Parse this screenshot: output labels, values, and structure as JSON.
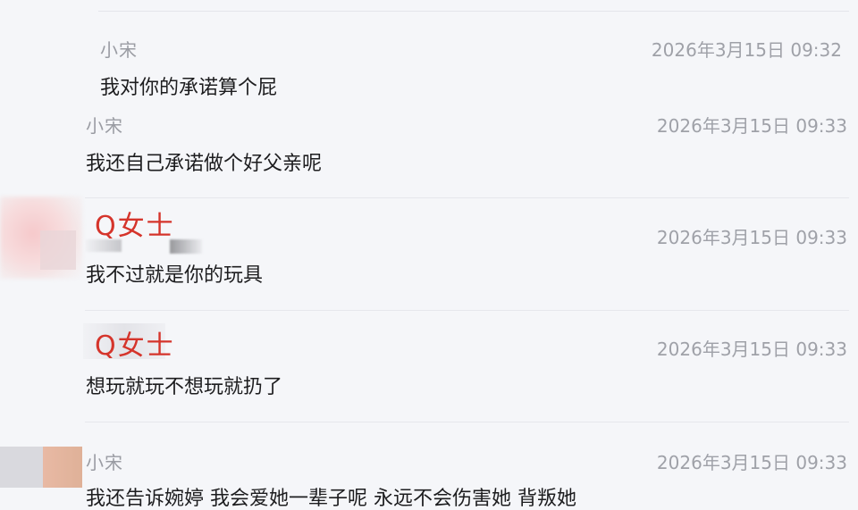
{
  "messages": [
    {
      "sender": "小宋",
      "time": "2026年3月15日 09:32",
      "text": "我对你的承诺算个屁"
    },
    {
      "sender": "小宋",
      "time": "2026年3月15日 09:33",
      "text": "我还自己承诺做个好父亲呢"
    },
    {
      "sender": "Q女士",
      "time": "2026年3月15日 09:33",
      "text": "我不过就是你的玩具"
    },
    {
      "sender": "Q女士",
      "time": "2026年3月15日 09:33",
      "text": "想玩就玩不想玩就扔了"
    },
    {
      "sender": "小宋",
      "time": "2026年3月15日 09:33",
      "text": "我还告诉婉婷 我会爱她一辈子呢 永远不会伤害她 背叛她"
    }
  ],
  "colors": {
    "background": "#f5f6f9",
    "sender_highlight": "#d5342b",
    "sender_plain": "#9a9ca3",
    "timestamp": "#9fa1a8",
    "message_text": "#1d1d1f"
  }
}
